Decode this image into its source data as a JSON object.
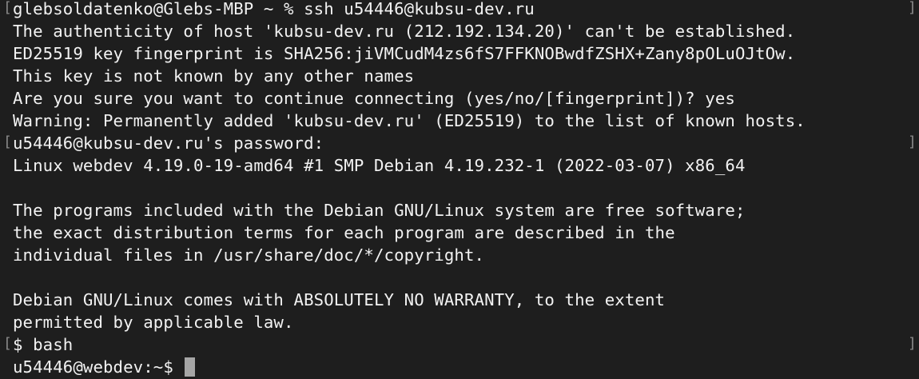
{
  "terminal": {
    "lines": [
      {
        "text": "glebsoldatenko@Glebs-MBP ~ % ssh u54446@kubsu-dev.ru",
        "mark_left": "[",
        "mark_right": "]"
      },
      {
        "text": "The authenticity of host 'kubsu-dev.ru (212.192.134.20)' can't be established.",
        "mark_left": "",
        "mark_right": ""
      },
      {
        "text": "ED25519 key fingerprint is SHA256:jiVMCudM4zs6fS7FFKNOBwdfZSHX+Zany8pOLuOJtOw.",
        "mark_left": "",
        "mark_right": ""
      },
      {
        "text": "This key is not known by any other names",
        "mark_left": "",
        "mark_right": ""
      },
      {
        "text": "Are you sure you want to continue connecting (yes/no/[fingerprint])? yes",
        "mark_left": "",
        "mark_right": ""
      },
      {
        "text": "Warning: Permanently added 'kubsu-dev.ru' (ED25519) to the list of known hosts.",
        "mark_left": "",
        "mark_right": ""
      },
      {
        "text": "u54446@kubsu-dev.ru's password:",
        "mark_left": "[",
        "mark_right": "]"
      },
      {
        "text": "Linux webdev 4.19.0-19-amd64 #1 SMP Debian 4.19.232-1 (2022-03-07) x86_64",
        "mark_left": "",
        "mark_right": ""
      },
      {
        "text": "",
        "mark_left": "",
        "mark_right": ""
      },
      {
        "text": "The programs included with the Debian GNU/Linux system are free software;",
        "mark_left": "",
        "mark_right": ""
      },
      {
        "text": "the exact distribution terms for each program are described in the",
        "mark_left": "",
        "mark_right": ""
      },
      {
        "text": "individual files in /usr/share/doc/*/copyright.",
        "mark_left": "",
        "mark_right": ""
      },
      {
        "text": "",
        "mark_left": "",
        "mark_right": ""
      },
      {
        "text": "Debian GNU/Linux comes with ABSOLUTELY NO WARRANTY, to the extent",
        "mark_left": "",
        "mark_right": ""
      },
      {
        "text": "permitted by applicable law.",
        "mark_left": "",
        "mark_right": ""
      },
      {
        "text": "$ bash",
        "mark_left": "[",
        "mark_right": "]"
      }
    ],
    "prompt": "u54446@webdev:~$ "
  },
  "colors": {
    "background": "#1e1e1e",
    "foreground": "#f2f2f2",
    "cursor": "#a6a6a6",
    "mark": "#8a8a8a"
  }
}
